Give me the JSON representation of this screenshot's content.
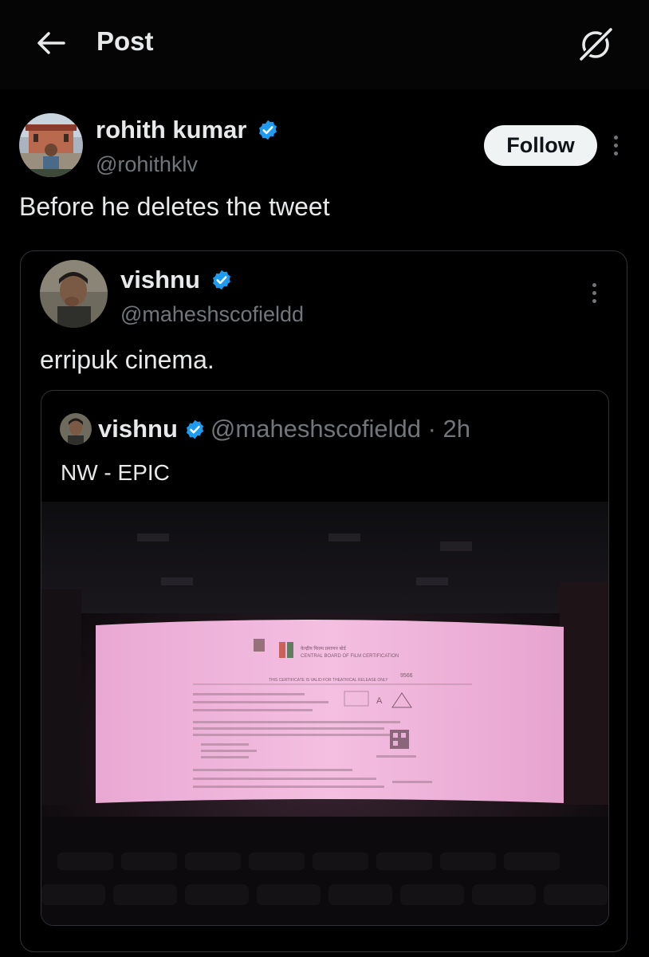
{
  "header": {
    "title": "Post"
  },
  "post": {
    "author_name": "rohith kumar",
    "author_handle": "@rohithklv",
    "follow_label": "Follow",
    "text": "Before he deletes the tweet"
  },
  "quoted": {
    "author_name": "vishnu",
    "author_handle": "@maheshscofieldd",
    "text": "erripuk cinema."
  },
  "nested_quote": {
    "author_name": "vishnu",
    "author_handle": "@maheshscofieldd · 2h",
    "text": "NW - EPIC"
  },
  "media_certificate": {
    "hindi_title": "केन्द्रीय फिल्म प्रमाणन बोर्ड",
    "org": "CENTRAL BOARD OF FILM CERTIFICATION",
    "validity": "THIS CERTIFICATE IS VALID FOR THEATRICAL RELEASE ONLY",
    "cert_number": "9566",
    "rating": "A"
  },
  "colors": {
    "background": "#000000",
    "text_primary": "#e7e9ea",
    "text_secondary": "#71767b",
    "verified_blue": "#1d9bf0",
    "border": "#2f3336",
    "follow_bg": "#eff3f4",
    "screen_pink": "#f2b7de"
  },
  "icons": {
    "back": "arrow-left-icon",
    "grok": "grok-slash-circle-icon",
    "verified": "verified-badge-icon",
    "more": "more-vertical-icon"
  }
}
